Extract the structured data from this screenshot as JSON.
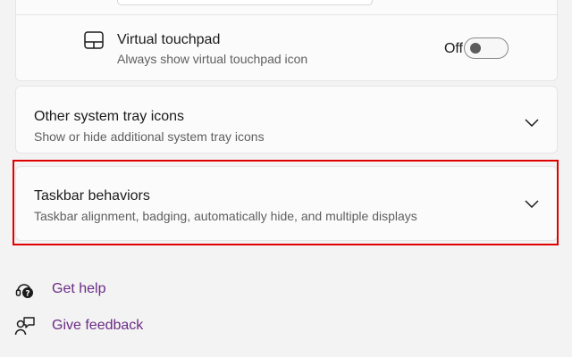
{
  "virtual_touchpad": {
    "title": "Virtual touchpad",
    "subtitle": "Always show virtual touchpad icon",
    "state_label": "Off",
    "enabled": false
  },
  "other_tray": {
    "title": "Other system tray icons",
    "subtitle": "Show or hide additional system tray icons"
  },
  "taskbar_behaviors": {
    "title": "Taskbar behaviors",
    "subtitle": "Taskbar alignment, badging, automatically hide, and multiple displays",
    "highlight_color": "#e00000"
  },
  "links": {
    "get_help": "Get help",
    "give_feedback": "Give feedback",
    "link_color": "#6b2c86"
  },
  "icons": {
    "touchpad": "touchpad-icon",
    "expand": "chevron-down-icon",
    "help": "help-icon",
    "feedback": "feedback-icon"
  }
}
